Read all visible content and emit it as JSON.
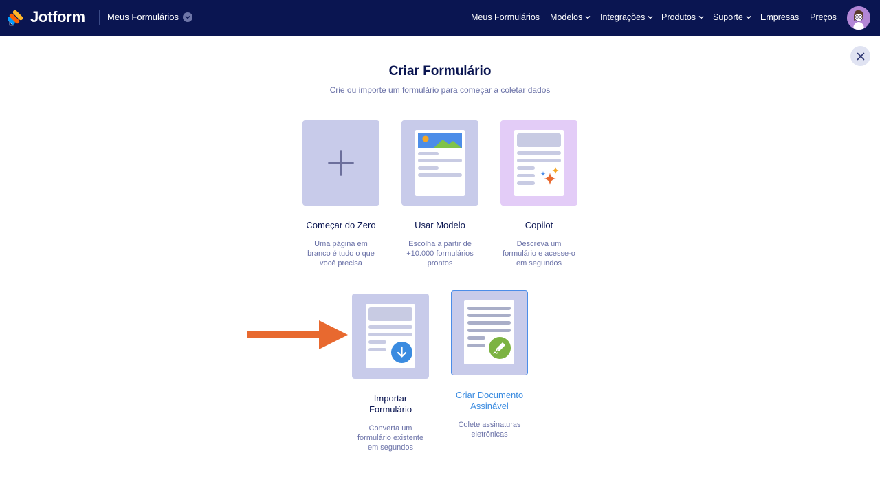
{
  "navbar": {
    "brand": "Jotform",
    "my_forms_label": "Meus Formulários",
    "links": [
      {
        "label": "Meus Formulários",
        "has_chevron": false
      },
      {
        "label": "Modelos",
        "has_chevron": true
      },
      {
        "label": "Integrações",
        "has_chevron": true
      },
      {
        "label": "Produtos",
        "has_chevron": true
      },
      {
        "label": "Suporte",
        "has_chevron": true
      },
      {
        "label": "Empresas",
        "has_chevron": false
      },
      {
        "label": "Preços",
        "has_chevron": false
      }
    ]
  },
  "modal": {
    "title": "Criar Formulário",
    "subtitle": "Crie ou importe um formulário para começar a coletar dados",
    "cards": [
      {
        "title": "Começar do Zero",
        "desc": [
          "Uma página em",
          "branco é tudo o que",
          "você precisa"
        ]
      },
      {
        "title": "Usar Modelo",
        "desc": [
          "Escolha a partir de",
          "+10.000 formulários",
          "prontos"
        ]
      },
      {
        "title": "Copilot",
        "desc": [
          "Descreva um",
          "formulário e acesse-o",
          "em segundos"
        ]
      },
      {
        "title": [
          "Importar",
          "Formulário"
        ],
        "desc": [
          "Converta um",
          "formulário existente",
          "em segundos"
        ]
      },
      {
        "title": [
          "Criar Documento",
          "Assinável"
        ],
        "desc": [
          "Colete assinaturas",
          "eletrônicas"
        ]
      }
    ]
  },
  "colors": {
    "navbar_bg": "#0a1551",
    "tile_bg": "#c8cbea",
    "copilot_tile_bg": "#e3ccf7",
    "selected_accent": "#3a8be0",
    "arrow": "#e8692f"
  },
  "icons": {
    "plus": "plus-icon",
    "close": "close-icon",
    "import": "download-icon",
    "sign": "pen-icon",
    "sparkle": "sparkle-icon"
  }
}
